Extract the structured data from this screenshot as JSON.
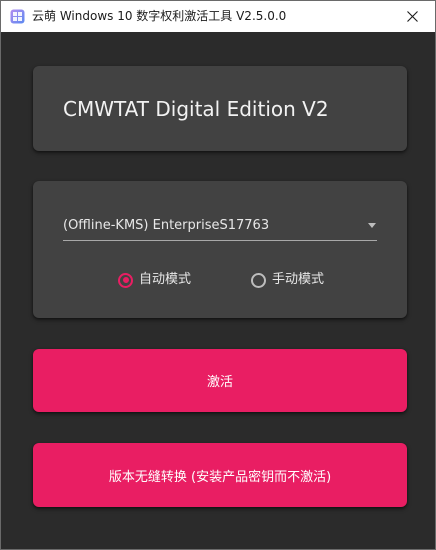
{
  "window": {
    "title": "云萌 Windows 10 数字权利激活工具 V2.5.0.0",
    "icon": "app-icon",
    "close_icon": "close-icon"
  },
  "colors": {
    "accent": "#e91e63",
    "background": "#2b2b2b",
    "card": "#424242"
  },
  "header": {
    "title": "CMWTAT Digital Edition V2"
  },
  "options": {
    "edition_select": {
      "value": "(Offline-KMS) EnterpriseS17763",
      "icon": "dropdown-arrow-icon"
    },
    "mode": {
      "auto_label": "自动模式",
      "manual_label": "手动模式",
      "selected": "auto"
    }
  },
  "actions": {
    "activate_label": "激活",
    "convert_label": "版本无缝转换 (安装产品密钥而不激活)"
  }
}
